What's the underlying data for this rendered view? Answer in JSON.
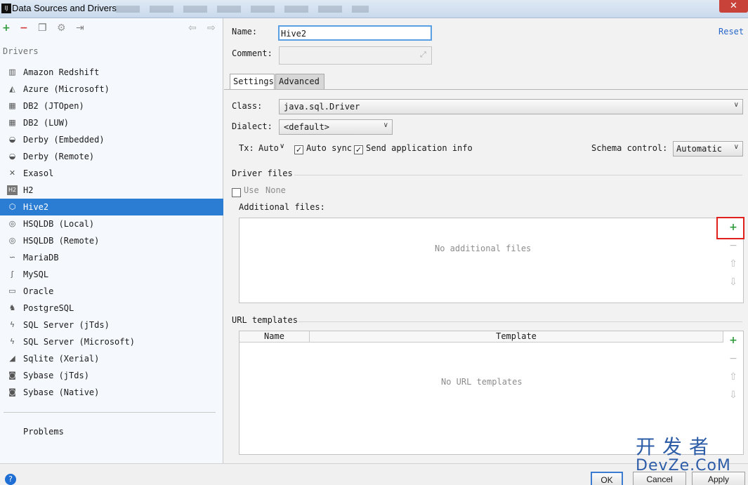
{
  "window": {
    "title": "Data Sources and Drivers",
    "close_glyph": "✕",
    "app_icon": "IJ"
  },
  "left_toolbar": {
    "add": "+",
    "remove": "−",
    "duplicate": "❐",
    "wrench": "⚙",
    "export": "⇥",
    "back": "⇦",
    "forward": "⇨"
  },
  "drivers_label": "Drivers",
  "drivers": [
    {
      "label": "Amazon Redshift",
      "icon": "redshift-icon",
      "glyph": "▥"
    },
    {
      "label": "Azure (Microsoft)",
      "icon": "azure-icon",
      "glyph": "◭"
    },
    {
      "label": "DB2 (JTOpen)",
      "icon": "db2-icon",
      "glyph": "▦"
    },
    {
      "label": "DB2 (LUW)",
      "icon": "db2-icon",
      "glyph": "▦"
    },
    {
      "label": "Derby (Embedded)",
      "icon": "derby-icon",
      "glyph": "◒"
    },
    {
      "label": "Derby (Remote)",
      "icon": "derby-icon",
      "glyph": "◒"
    },
    {
      "label": "Exasol",
      "icon": "exasol-icon",
      "glyph": "✕"
    },
    {
      "label": "H2",
      "icon": "h2-icon",
      "glyph": "H2"
    },
    {
      "label": "Hive2",
      "icon": "hive-icon",
      "glyph": "⬡"
    },
    {
      "label": "HSQLDB (Local)",
      "icon": "hsqldb-icon",
      "glyph": "◎"
    },
    {
      "label": "HSQLDB (Remote)",
      "icon": "hsqldb-icon",
      "glyph": "◎"
    },
    {
      "label": "MariaDB",
      "icon": "mariadb-icon",
      "glyph": "∽"
    },
    {
      "label": "MySQL",
      "icon": "mysql-icon",
      "glyph": "ʃ"
    },
    {
      "label": "Oracle",
      "icon": "oracle-icon",
      "glyph": "▭"
    },
    {
      "label": "PostgreSQL",
      "icon": "postgresql-icon",
      "glyph": "♞"
    },
    {
      "label": "SQL Server (jTds)",
      "icon": "sqlserver-icon",
      "glyph": "ϟ"
    },
    {
      "label": "SQL Server (Microsoft)",
      "icon": "sqlserver-icon",
      "glyph": "ϟ"
    },
    {
      "label": "Sqlite (Xerial)",
      "icon": "sqlite-icon",
      "glyph": "◢"
    },
    {
      "label": "Sybase (jTds)",
      "icon": "sybase-icon",
      "glyph": "◙"
    },
    {
      "label": "Sybase (Native)",
      "icon": "sybase-icon",
      "glyph": "◙"
    }
  ],
  "selected_driver_index": 8,
  "problems_label": "Problems",
  "form": {
    "name_label": "Name:",
    "name_value": "Hive2",
    "comment_label": "Comment:",
    "comment_value": "",
    "expand_glyph": "⤢",
    "reset_label": "Reset"
  },
  "tabs": [
    {
      "label": "Settings",
      "active": true
    },
    {
      "label": "Advanced",
      "active": false
    }
  ],
  "settings": {
    "class_label": "Class:",
    "class_value": "java.sql.Driver",
    "dialect_label": "Dialect:",
    "dialect_value": "<default>",
    "tx_label": "Tx:",
    "tx_value": "Auto",
    "auto_sync_label": "Auto sync",
    "auto_sync_checked": true,
    "send_app_info_label": "Send application info",
    "send_app_info_checked": true,
    "schema_control_label": "Schema control:",
    "schema_control_value": "Automatic",
    "arrow": "∨",
    "check_glyph": "✓"
  },
  "driver_files": {
    "section_label": "Driver files",
    "use_label": "Use",
    "use_value": "None",
    "use_checked": false,
    "additional_files_label": "Additional files:",
    "empty_text": "No additional files",
    "buttons": {
      "add": "+",
      "remove": "−",
      "up": "⇧",
      "down": "⇩"
    }
  },
  "url_templates": {
    "section_label": "URL templates",
    "columns": [
      "Name",
      "Template"
    ],
    "empty_text": "No URL templates",
    "buttons": {
      "add": "+",
      "remove": "−",
      "up": "⇧",
      "down": "⇩"
    }
  },
  "footer": {
    "help_glyph": "?",
    "ok_label": "OK",
    "cancel_label": "Cancel",
    "apply_label": "Apply"
  },
  "watermark": {
    "line1": "开发者",
    "line2": "DevZe.CoM"
  },
  "colors": {
    "selection": "#2a7dd3",
    "add_green": "#2e9b3a",
    "remove_red": "#d23b3b",
    "highlight_red": "#e0201a",
    "link_blue": "#2867c9"
  }
}
